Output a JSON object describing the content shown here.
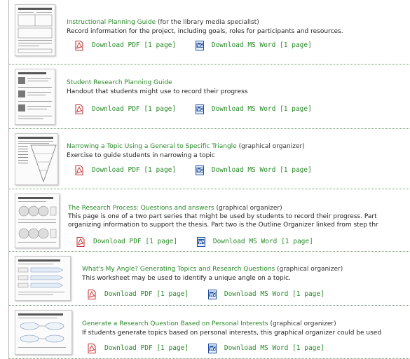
{
  "resources": [
    {
      "title": "Instructional Planning Guide",
      "tag": "(for the library media specialist)",
      "description": [
        "Record information for the project, including goals, roles for participants and resources."
      ],
      "pdf_label": "Download PDF [1 page]",
      "word_label": "Download MS Word [1 page]",
      "pdf_icon": "pdf-icon",
      "word_icon": "ms-word-icon"
    },
    {
      "title": "Student Research Planning Guide",
      "tag": "",
      "description": [
        "Handout that students might use to record their progress"
      ],
      "pdf_label": "Download PDF [1 page]",
      "word_label": "Download MS Word [1 page]",
      "pdf_icon": "pdf-icon",
      "word_icon": "ms-word-icon"
    },
    {
      "title": "Narrowing a Topic Using a General to Specific Triangle",
      "tag": "(graphical organizer)",
      "description": [
        "Exercise to guide students in narrowing a topic"
      ],
      "pdf_label": "Download PDF [1 page]",
      "word_label": "Download MS Word [1 page]",
      "pdf_icon": "pdf-icon",
      "word_icon": "ms-word-icon"
    },
    {
      "title": "The Research Process: Questions and answers",
      "tag": "(graphical organizer)",
      "description": [
        "This page is one of a two part series that might be used by students to record their progress. Part",
        "organizing information to support the thesis. Part two is the Outline Organizer linked from step thr"
      ],
      "pdf_label": "Download PDF [1 page]",
      "word_label": "Download MS Word [1 page]",
      "pdf_icon": "pdf-icon",
      "word_icon": "ms-word-icon"
    },
    {
      "title": "What's My Angle? Generating Topics and Research Questions",
      "tag": "(graphical organizer)",
      "description": [
        "This worksheet may be used to identify a unique angle on a topic."
      ],
      "pdf_label": "Download PDF [1 page]",
      "word_label": "Download MS Word [1 page]",
      "pdf_icon": "pdf-icon",
      "word_icon": "ms-word-icon"
    },
    {
      "title": "Generate a Research Question Based on Personal Interests",
      "tag": "(graphical organizer)",
      "description": [
        "If students generate topics based on personal interests, this graphical organizer could be used"
      ],
      "pdf_label": "Download PDF [1 page]",
      "word_label": "Download MS Word [1 page]",
      "pdf_icon": "pdf-icon",
      "word_icon": "ms-word-icon"
    }
  ],
  "colors": {
    "link": "#2a8a2a",
    "divider": "#6f9a6f",
    "pdf": "#c62828",
    "word": "#1f4fa0"
  }
}
